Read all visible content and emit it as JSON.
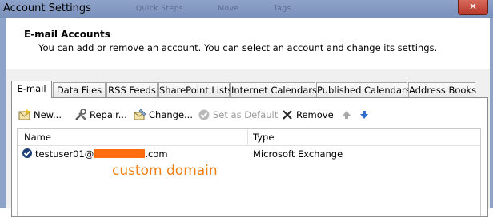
{
  "window": {
    "title": "Account Settings",
    "ghost_tabs": [
      "Quick Steps",
      "Move",
      "Tags"
    ],
    "close_glyph": "✕"
  },
  "header": {
    "title": "E-mail Accounts",
    "description": "You can add or remove an account. You can select an account and change its settings."
  },
  "tabs": [
    {
      "label": "E-mail",
      "active": true
    },
    {
      "label": "Data Files"
    },
    {
      "label": "RSS Feeds"
    },
    {
      "label": "SharePoint Lists"
    },
    {
      "label": "Internet Calendars"
    },
    {
      "label": "Published Calendars"
    },
    {
      "label": "Address Books"
    }
  ],
  "toolbar": {
    "new": "New...",
    "repair": "Repair...",
    "change": "Change...",
    "set_default": "Set as Default",
    "remove": "Remove"
  },
  "list": {
    "columns": {
      "name": "Name",
      "type": "Type"
    },
    "rows": [
      {
        "name_prefix": "testuser01@",
        "name_suffix": ".com",
        "type": "Microsoft Exchange"
      }
    ]
  },
  "annotation": "custom domain",
  "colors": {
    "redaction": "#ff6d10",
    "annotation": "#f07f13",
    "title_bar": "#8ea3c9"
  }
}
